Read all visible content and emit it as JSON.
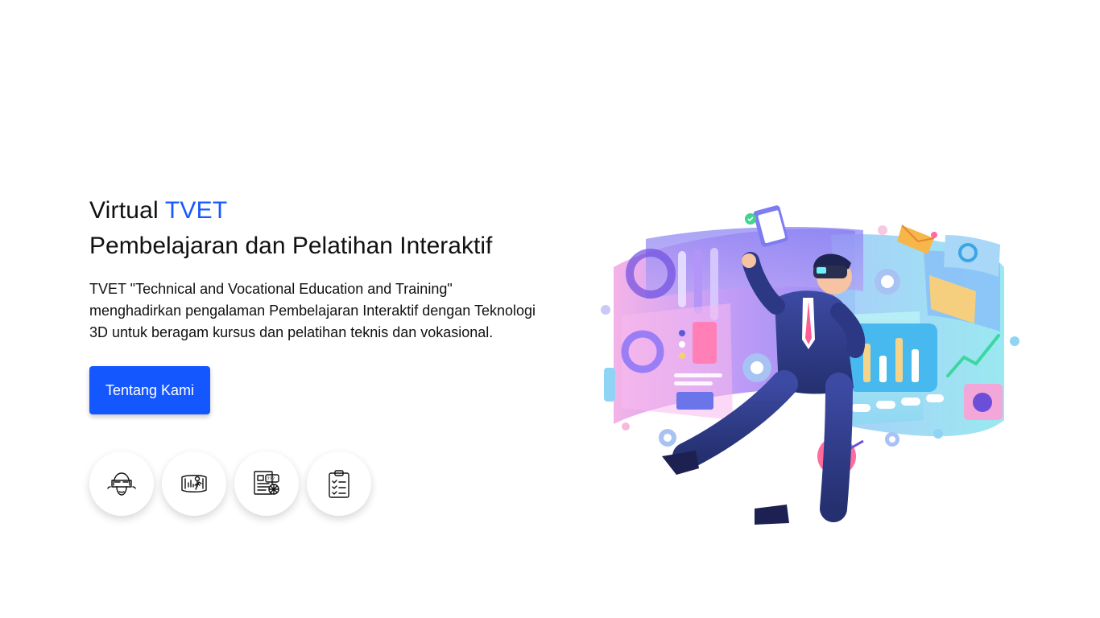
{
  "hero": {
    "title_prefix": "Virtual",
    "title_accent": "TVET",
    "subtitle": "Pembelajaran dan Pelatihan Interaktif",
    "description": "TVET \"Technical and Vocational Education and Training\" menghadirkan pengalaman Pembelajaran Interaktif dengan Teknologi 3D untuk beragam kursus dan pelatihan teknis dan vokasional.",
    "cta_label": "Tentang Kami"
  },
  "features": [
    {
      "icon": "vr-headset-icon"
    },
    {
      "icon": "interactive-display-icon"
    },
    {
      "icon": "quiz-icon"
    },
    {
      "icon": "checklist-icon"
    }
  ],
  "colors": {
    "accent": "#1758ff",
    "button": "#1557ff",
    "text": "#111111",
    "background": "#ffffff"
  },
  "illustration": "vr-learning-illustration"
}
